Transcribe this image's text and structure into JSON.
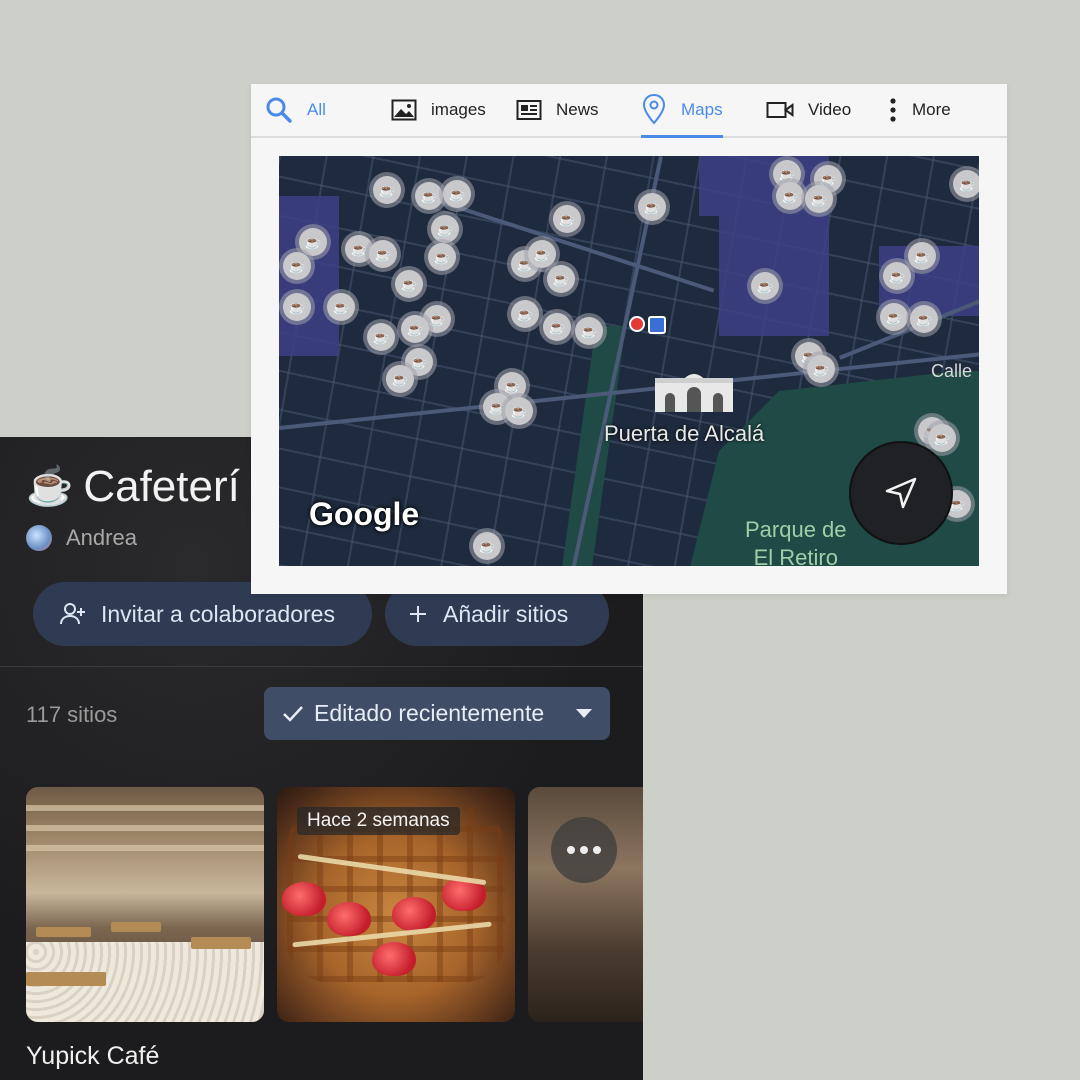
{
  "search_tabs": {
    "all": "All",
    "images": "images",
    "news": "News",
    "maps": "Maps",
    "video": "Video",
    "more": "More",
    "active_color": "#4a8be8"
  },
  "map": {
    "poi_label": "Puerta de Alcalá",
    "park_label_line1": "Parque de",
    "park_label_line2": "El Retiro",
    "street_label": "Calle",
    "logo_text": "Google",
    "pin_icon": "☕"
  },
  "list": {
    "title_icon": "☕",
    "title": "Cafeterí",
    "owner": "Andrea",
    "invite_label": "Invitar a colaboradores",
    "add_label": "Añadir sitios",
    "count_text": "117 sitios",
    "sort_label": "Editado recientemente",
    "card2_badge": "Hace 2 semanas",
    "first_place_name": "Yupick Café"
  },
  "colors": {
    "background": "#cdd0c9",
    "panel": "#1f1f21",
    "pill": "#2f3b52",
    "sort_chip": "#3f4d66"
  }
}
